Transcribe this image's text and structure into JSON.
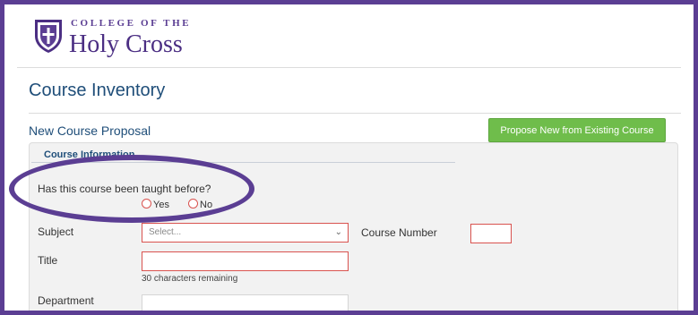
{
  "header": {
    "logo_small": "COLLEGE OF THE",
    "logo_big": "Holy Cross"
  },
  "page": {
    "title": "Course Inventory",
    "section": "New Course Proposal",
    "propose_button": "Propose New from Existing Course"
  },
  "form": {
    "tab_label": "Course Information",
    "question": "Has this course been taught before?",
    "options": {
      "yes": "Yes",
      "no": "No"
    },
    "subject_label": "Subject",
    "subject_placeholder": "Select...",
    "course_number_label": "Course Number",
    "title_label": "Title",
    "title_remaining": "30 characters remaining",
    "department_label": "Department"
  },
  "colors": {
    "brand_purple": "#5b3e93",
    "title_blue": "#1f4e79",
    "button_green": "#6fbd4b",
    "error_red": "#d9534f"
  },
  "icons": {
    "logo": "shield-logo-icon",
    "dropdown": "chevron-down-icon",
    "radio": "radio-button-icon"
  }
}
